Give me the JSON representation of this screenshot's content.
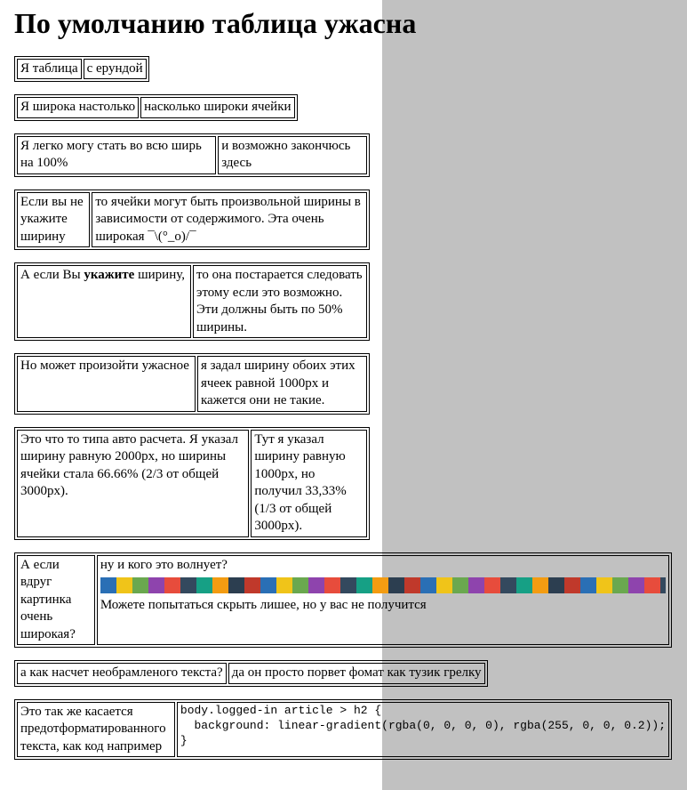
{
  "heading": "По умолчанию таблица ужасна",
  "t1": {
    "c1": "Я таблица",
    "c2": "с ерундой"
  },
  "t2": {
    "c1": "Я широка настолько",
    "c2": "насколько широки ячейки"
  },
  "t3": {
    "c1": "Я легко могу стать во всю ширь на 100%",
    "c2": "и возможно закончюсь здесь"
  },
  "t4": {
    "c1": "Если вы не укажите ширину",
    "c2": "то ячейки могут быть произвольной ширины в зависимости от содержимого. Эта очень широкая ¯\\(°_o)/¯"
  },
  "t5": {
    "c1_pre": "А если Вы ",
    "c1_bold": "укажите",
    "c1_post": " ширину,",
    "c2": "то она постарается следовать этому если это возможно. Эти должны быть по 50% ширины."
  },
  "t6": {
    "c1": "Но может произойти ужасное",
    "c2": "я задал ширину обоих этих ячеек равной 1000px и кажется они не такие."
  },
  "t7": {
    "c1": "Это что то типа авто расчета. Я указал ширину равную 2000px, но ширины ячейки стала 66.66% (2/3 от общей 3000px).",
    "c2": "Тут я указал ширину равную 1000px, но получил 33,33% (1/3 от общей 3000px)."
  },
  "t8": {
    "c1": "А если вдруг картинка очень широкая?",
    "c2a": "ну и кого это волнует?",
    "c2b": "Можете попытаться скрыть лишее, но у вас не получится"
  },
  "t9": {
    "c1": "а как насчет необрамленого текста?",
    "c2": "да он просто порвет фомат как тузик грелку"
  },
  "t10": {
    "c1": "Это так же касается предотформатированного текста, как код например",
    "c2": "body.logged-in article > h2 {\n  background: linear-gradient(rgba(0, 0, 0, 0), rgba(255, 0, 0, 0.2));\n}"
  }
}
